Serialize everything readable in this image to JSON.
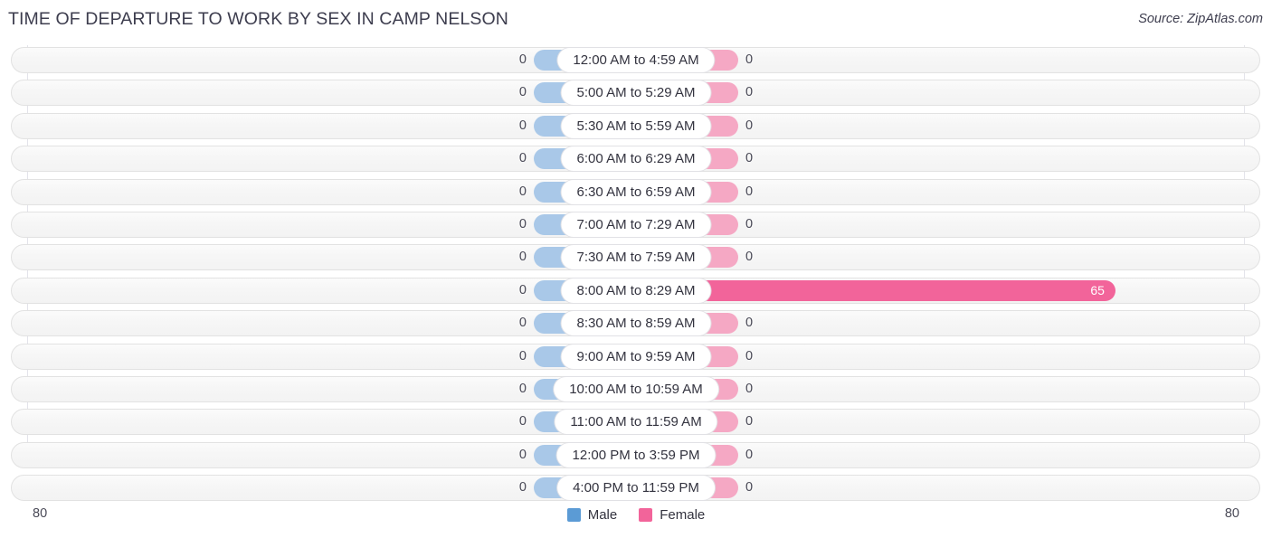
{
  "header": {
    "title": "TIME OF DEPARTURE TO WORK BY SEX IN CAMP NELSON",
    "source": "Source: ZipAtlas.com"
  },
  "legend": {
    "male_label": "Male",
    "female_label": "Female",
    "male_color": "#5b9bd5",
    "female_color": "#f2649a"
  },
  "axis": {
    "left_end": "80",
    "right_end": "80"
  },
  "chart_data": {
    "type": "bar",
    "title": "TIME OF DEPARTURE TO WORK BY SEX IN CAMP NELSON",
    "subtitle": "",
    "xlabel": "",
    "ylabel": "",
    "orientation": "horizontal",
    "style": "diverging-bidirectional",
    "legend_position": "bottom-center",
    "grid": true,
    "axis_max": 80,
    "axis_left_label": "80",
    "axis_right_label": "80",
    "categories": [
      "12:00 AM to 4:59 AM",
      "5:00 AM to 5:29 AM",
      "5:30 AM to 5:59 AM",
      "6:00 AM to 6:29 AM",
      "6:30 AM to 6:59 AM",
      "7:00 AM to 7:29 AM",
      "7:30 AM to 7:59 AM",
      "8:00 AM to 8:29 AM",
      "8:30 AM to 8:59 AM",
      "9:00 AM to 9:59 AM",
      "10:00 AM to 10:59 AM",
      "11:00 AM to 11:59 AM",
      "12:00 PM to 3:59 PM",
      "4:00 PM to 11:59 PM"
    ],
    "series": [
      {
        "name": "Male",
        "color": "#a9c8e8",
        "values": [
          0,
          0,
          0,
          0,
          0,
          0,
          0,
          0,
          0,
          0,
          0,
          0,
          0,
          0
        ]
      },
      {
        "name": "Female",
        "color": "#f5a8c4",
        "values": [
          0,
          0,
          0,
          0,
          0,
          0,
          0,
          65,
          0,
          0,
          0,
          0,
          0,
          0
        ]
      }
    ]
  },
  "rows": [
    {
      "label": "12:00 AM to 4:59 AM",
      "male": "0",
      "female": "0",
      "female_value": 0,
      "female_highlight": false
    },
    {
      "label": "5:00 AM to 5:29 AM",
      "male": "0",
      "female": "0",
      "female_value": 0,
      "female_highlight": false
    },
    {
      "label": "5:30 AM to 5:59 AM",
      "male": "0",
      "female": "0",
      "female_value": 0,
      "female_highlight": false
    },
    {
      "label": "6:00 AM to 6:29 AM",
      "male": "0",
      "female": "0",
      "female_value": 0,
      "female_highlight": false
    },
    {
      "label": "6:30 AM to 6:59 AM",
      "male": "0",
      "female": "0",
      "female_value": 0,
      "female_highlight": false
    },
    {
      "label": "7:00 AM to 7:29 AM",
      "male": "0",
      "female": "0",
      "female_value": 0,
      "female_highlight": false
    },
    {
      "label": "7:30 AM to 7:59 AM",
      "male": "0",
      "female": "0",
      "female_value": 0,
      "female_highlight": false
    },
    {
      "label": "8:00 AM to 8:29 AM",
      "male": "0",
      "female": "65",
      "female_value": 65,
      "female_highlight": true
    },
    {
      "label": "8:30 AM to 8:59 AM",
      "male": "0",
      "female": "0",
      "female_value": 0,
      "female_highlight": false
    },
    {
      "label": "9:00 AM to 9:59 AM",
      "male": "0",
      "female": "0",
      "female_value": 0,
      "female_highlight": false
    },
    {
      "label": "10:00 AM to 10:59 AM",
      "male": "0",
      "female": "0",
      "female_value": 0,
      "female_highlight": false
    },
    {
      "label": "11:00 AM to 11:59 AM",
      "male": "0",
      "female": "0",
      "female_value": 0,
      "female_highlight": false
    },
    {
      "label": "12:00 PM to 3:59 PM",
      "male": "0",
      "female": "0",
      "female_value": 0,
      "female_highlight": false
    },
    {
      "label": "4:00 PM to 11:59 PM",
      "male": "0",
      "female": "0",
      "female_value": 0,
      "female_highlight": false
    }
  ]
}
